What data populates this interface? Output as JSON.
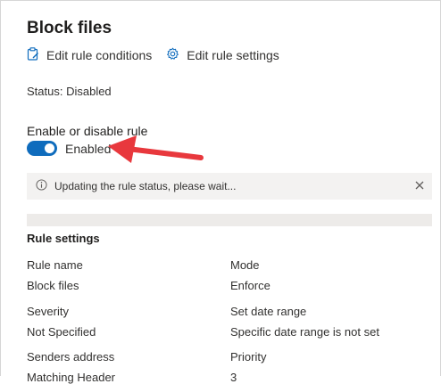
{
  "header": {
    "title": "Block files",
    "edit_conditions_label": "Edit rule conditions",
    "edit_settings_label": "Edit rule settings"
  },
  "status_text": "Status: Disabled",
  "toggle": {
    "label": "Enable or disable rule",
    "state_text": "Enabled",
    "on": true
  },
  "banner": {
    "message": "Updating the rule status, please wait..."
  },
  "rule_settings": {
    "title": "Rule settings",
    "rule_name_label": "Rule name",
    "rule_name_value": "Block files",
    "mode_label": "Mode",
    "mode_value": "Enforce",
    "severity_label": "Severity",
    "severity_value": "Not Specified",
    "date_range_label": "Set date range",
    "date_range_value": "Specific date range is not set",
    "senders_label": "Senders address",
    "senders_value": "Matching Header",
    "priority_label": "Priority",
    "priority_value": "3"
  },
  "colors": {
    "toggle_on": "#0f6cbd",
    "annotation_arrow": "#e8383d",
    "banner_bg": "#f3f2f1"
  },
  "icons": {
    "edit_conditions": "clipboard-edit-icon",
    "edit_settings": "gear-icon",
    "banner_info": "info-icon",
    "banner_close": "close-icon"
  }
}
